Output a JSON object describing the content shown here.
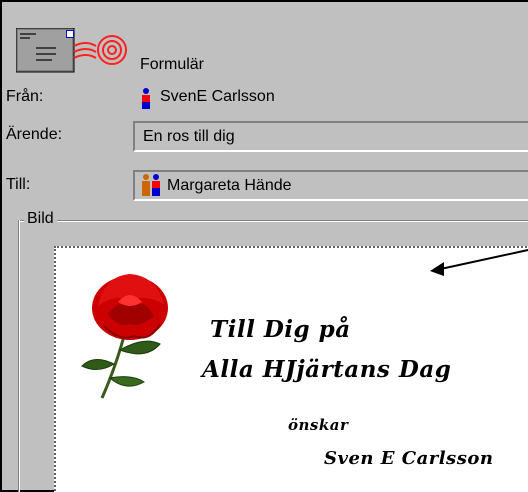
{
  "form": {
    "title": "Formulär"
  },
  "fields": {
    "from_label": "Från:",
    "from_value": "SvenE Carlsson",
    "subject_label": "Ärende:",
    "subject_value": "En ros till dig",
    "to_label": "Till:",
    "to_value": "Margareta Hände"
  },
  "group": {
    "label": "Bild"
  },
  "card": {
    "line1": "Till Dig på",
    "line2": "Alla HJjärtans Dag",
    "line3": "önskar",
    "line4": "Sven E Carlsson"
  },
  "icons": {
    "logo": "envelope-stamp-icon",
    "from": "person-icon",
    "to": "people-icon",
    "image": "rose-icon",
    "pointer": "arrow-icon"
  },
  "colors": {
    "background": "#c0c0c0",
    "rose": "#cc0000"
  }
}
